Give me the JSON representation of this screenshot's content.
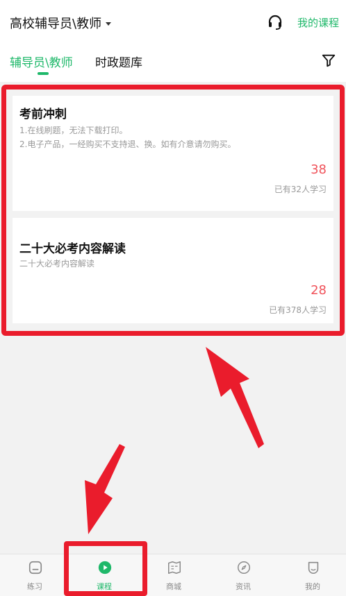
{
  "header": {
    "category_label": "高校辅导员\\教师",
    "my_courses_label": "我的课程"
  },
  "tabs": [
    {
      "label": "辅导员\\教师",
      "active": true
    },
    {
      "label": "时政题库",
      "active": false
    }
  ],
  "courses": [
    {
      "title": "考前冲刺",
      "desc_lines": [
        "1.在线刷题，无法下载打印。",
        "2.电子产品，一经购买不支持退、换。如有介意请勿购买。"
      ],
      "price": "38",
      "learners": "已有32人学习"
    },
    {
      "title": "二十大必考内容解读",
      "desc_lines": [
        "二十大必考内容解读"
      ],
      "price": "28",
      "learners": "已有378人学习"
    }
  ],
  "bottom_nav": [
    {
      "label": "练习",
      "icon": "practice-icon",
      "active": false
    },
    {
      "label": "课程",
      "icon": "course-play-icon",
      "active": true
    },
    {
      "label": "商城",
      "icon": "mall-book-icon",
      "active": false
    },
    {
      "label": "资讯",
      "icon": "news-compass-icon",
      "active": false
    },
    {
      "label": "我的",
      "icon": "profile-icon",
      "active": false
    }
  ],
  "colors": {
    "accent": "#1fb86a",
    "price": "#f0525a",
    "annotation_red": "#ea1c2c"
  }
}
